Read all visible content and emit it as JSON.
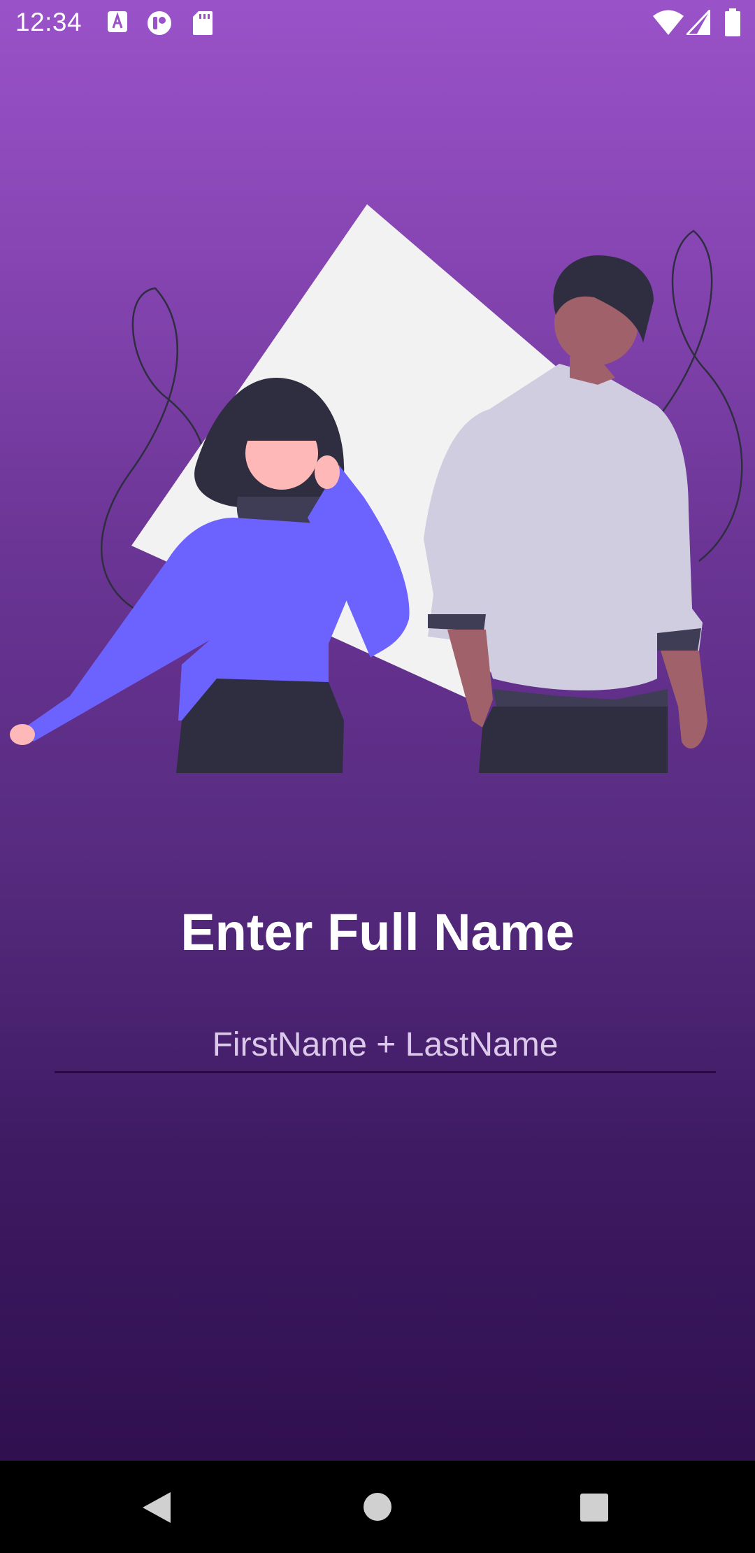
{
  "status_bar": {
    "time": "12:34",
    "notification_icons": [
      "a-icon",
      "circle-app-icon",
      "sd-card-icon"
    ],
    "system_icons": [
      "wifi-icon",
      "signal-icon",
      "battery-icon"
    ]
  },
  "illustration": {
    "name": "two-people-illustration",
    "colors": {
      "triangle": "#f2f2f2",
      "sweater": "#6c63ff",
      "shirt": "#d0cde1",
      "dark": "#2f2e41",
      "skin_light": "#ffb8b8",
      "skin_dark": "#a0616a"
    }
  },
  "main": {
    "title": "Enter Full Name",
    "name_input": {
      "placeholder": "FirstName + LastName",
      "value": ""
    }
  },
  "nav_bar": {
    "buttons": [
      "back-icon",
      "home-icon",
      "recents-icon"
    ]
  },
  "theme": {
    "gradient_top": "#9a52c8",
    "gradient_bottom": "#2c0c4a"
  }
}
